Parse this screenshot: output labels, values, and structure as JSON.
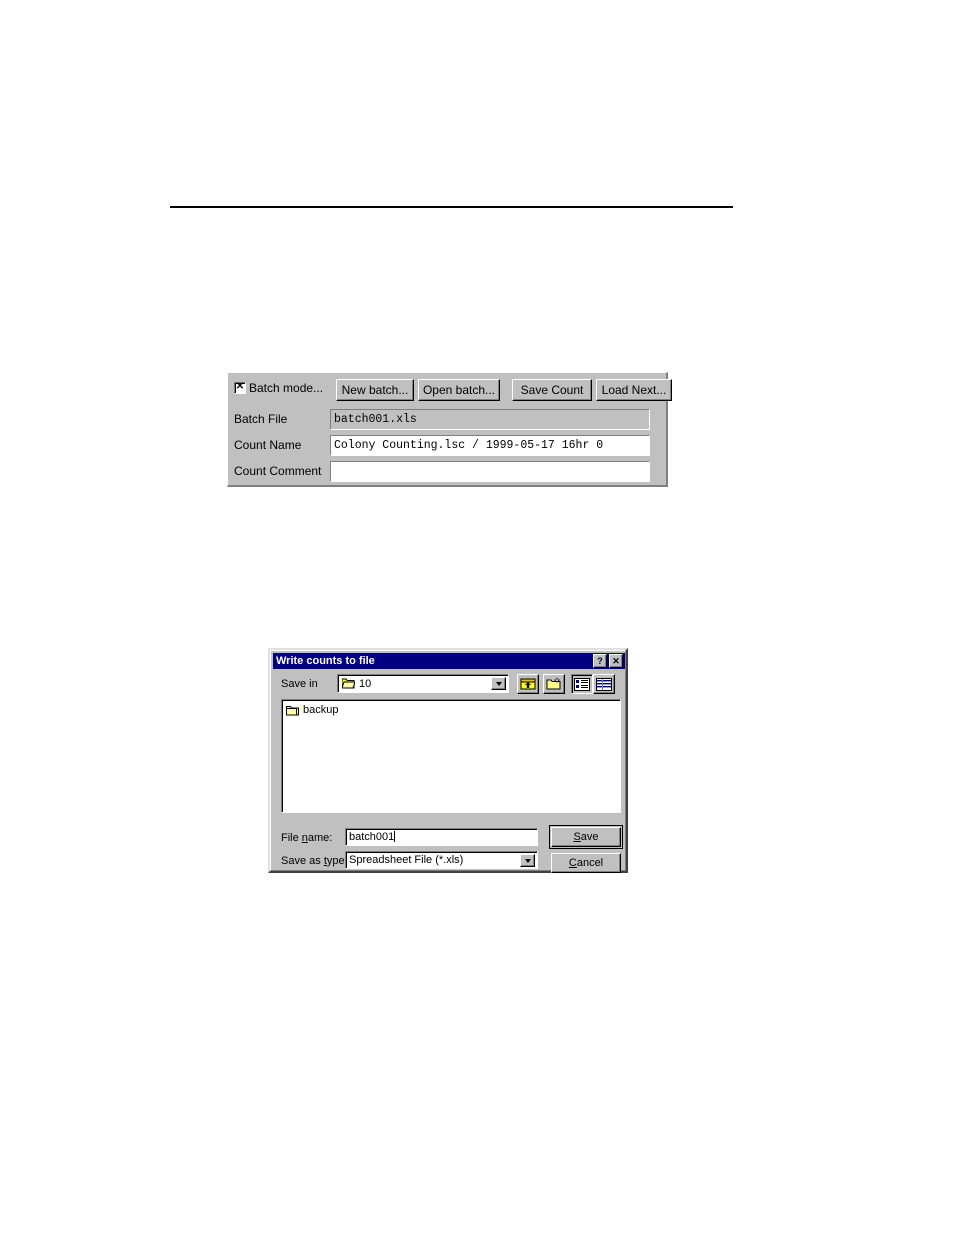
{
  "page": {
    "rule": "horizontal-rule"
  },
  "batch_panel": {
    "checkbox": {
      "label": "Batch mode...",
      "checked": true,
      "state_glyph": "x"
    },
    "buttons": [
      {
        "id": "new-batch",
        "label": "New batch..."
      },
      {
        "id": "open-batch",
        "label": "Open batch..."
      },
      {
        "id": "save-count",
        "label": "Save Count"
      },
      {
        "id": "load-next",
        "label": "Load Next..."
      }
    ],
    "fields": [
      {
        "id": "batch-file",
        "label": "Batch File",
        "value": "batch001.xls",
        "readonly": true
      },
      {
        "id": "count-name",
        "label": "Count Name",
        "value": "Colony Counting.lsc / 1999-05-17 16hr 0",
        "readonly": false
      },
      {
        "id": "count-comment",
        "label": "Count Comment",
        "value": "",
        "readonly": false
      }
    ]
  },
  "save_dialog": {
    "title": "Write counts to file",
    "title_buttons": [
      {
        "id": "help",
        "glyph": "?"
      },
      {
        "id": "close",
        "glyph": "✕"
      }
    ],
    "save_in": {
      "label": "Save in",
      "value": "10",
      "icon": "open-folder-icon"
    },
    "toolbar": [
      {
        "id": "up-one-level",
        "icon": "up-one-level-icon",
        "pressed": false
      },
      {
        "id": "create-folder",
        "icon": "new-folder-icon",
        "pressed": false
      },
      {
        "id": "list-view",
        "icon": "list-view-icon",
        "pressed": true
      },
      {
        "id": "details-view",
        "icon": "details-view-icon",
        "pressed": false
      }
    ],
    "file_list": [
      {
        "name": "backup",
        "icon": "folder-icon"
      }
    ],
    "file_name": {
      "label_prefix": "File ",
      "label_accel": "n",
      "label_suffix": "ame:",
      "value": "batch001"
    },
    "save_as_type": {
      "label_prefix": "Save as ",
      "label_accel": "t",
      "label_suffix": "ype:",
      "value": "Spreadsheet File (*.xls)"
    },
    "buttons": [
      {
        "id": "save",
        "prefix": "",
        "accel": "S",
        "suffix": "ave",
        "default": true
      },
      {
        "id": "cancel",
        "prefix": "",
        "accel": "C",
        "suffix": "ancel",
        "default": false
      }
    ]
  },
  "colors": {
    "face": "#c0c0c0",
    "titlebar": "#000080",
    "titlebar_text": "#ffffff",
    "field_bg": "#ffffff",
    "folder_yellow": "#ffff00"
  }
}
